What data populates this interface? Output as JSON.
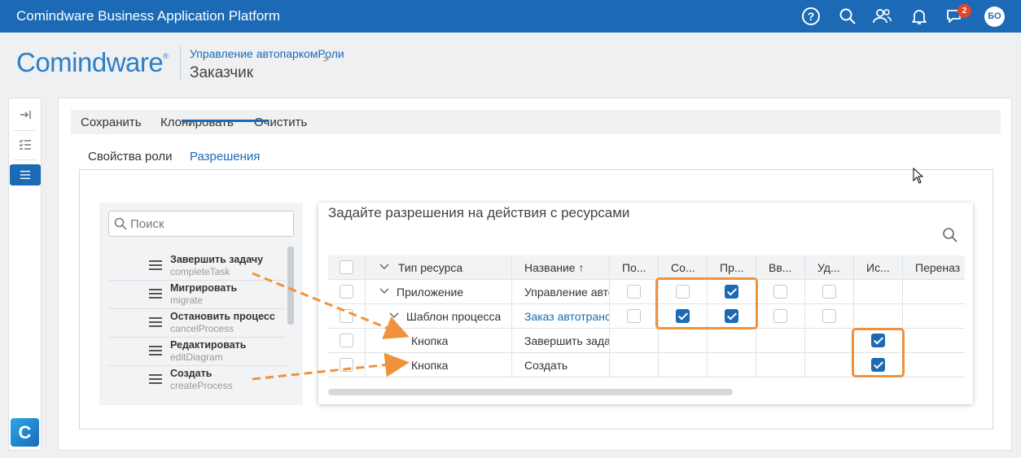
{
  "app": {
    "title": "Comindware Business Application Platform",
    "notification_count": "2",
    "user_initials": "БО",
    "accent_color": "#1c6ab5"
  },
  "brand": {
    "logo_text": "Comindware",
    "logo_mark": "®"
  },
  "breadcrumb": {
    "items": [
      "Управление автопарком",
      "Роли"
    ],
    "separator": ">",
    "title": "Заказчик"
  },
  "sidebar": {
    "icons": [
      "collapse-icon",
      "checklist-icon",
      "list-icon"
    ],
    "logo_letter": "C"
  },
  "toolbar": {
    "save": "Сохранить",
    "clone": "Клонировать",
    "clear": "Очистить"
  },
  "tabs": {
    "properties": "Свойства роли",
    "permissions": "Разрешения"
  },
  "list": {
    "search_placeholder": "Поиск",
    "items": [
      {
        "title": "Завершить задачу",
        "code": "completeTask"
      },
      {
        "title": "Мигрировать",
        "code": "migrate"
      },
      {
        "title": "Остановить процесс",
        "code": "cancelProcess"
      },
      {
        "title": "Редактировать",
        "code": "editDiagram"
      },
      {
        "title": "Создать",
        "code": "createProcess"
      }
    ]
  },
  "permissions": {
    "title": "Задайте разрешения на действия с ресурсами",
    "headers": {
      "type": "Тип ресурса",
      "name": "Название ↑",
      "c1": "По...",
      "c2": "Со...",
      "c3": "Пр...",
      "c4": "Вв...",
      "c5": "Уд...",
      "c6": "Ис...",
      "c7": "Переназ"
    },
    "rows": [
      {
        "type": "Приложение",
        "name": "Управление авто",
        "checks": [
          false,
          false,
          true,
          false,
          false
        ]
      },
      {
        "type": "Шаблон процесса",
        "name": "Заказ автотранс",
        "checks": [
          false,
          true,
          true,
          false,
          false
        ]
      },
      {
        "type": "Кнопка",
        "name": "Завершить задач",
        "execute": true
      },
      {
        "type": "Кнопка",
        "name": "Создать",
        "execute": true
      }
    ]
  },
  "colors": {
    "highlight": "#f0923d",
    "checked": "#1c6ab5"
  }
}
